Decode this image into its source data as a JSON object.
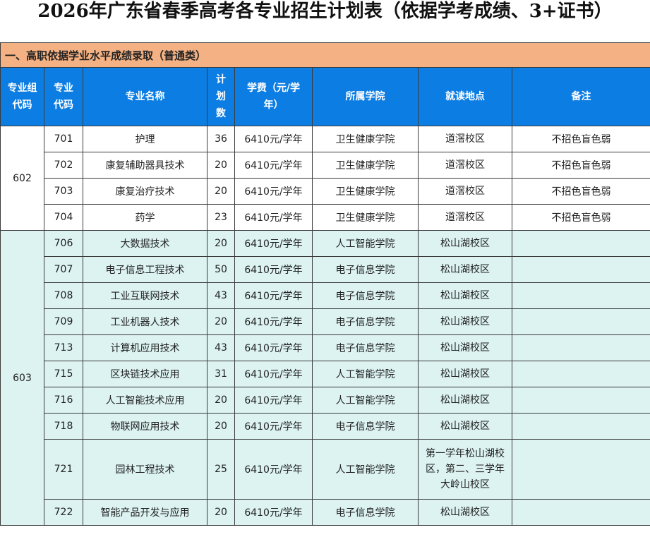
{
  "title": "2026年广东省春季高考各专业招生计划表（依据学考成绩、3+证书）",
  "section": "一、高职依据学业水平成绩录取（普通类）",
  "headers": {
    "group_code": "专业组代码",
    "major_code": "专业代码",
    "major_name": "专业名称",
    "plan": "计划数",
    "tuition": "学费（元/学年）",
    "college": "所属学院",
    "campus": "就读地点",
    "remark": "备注"
  },
  "groups": [
    {
      "code": "602",
      "rows": [
        {
          "code": "701",
          "name": "护理",
          "plan": "36",
          "fee": "6410元/学年",
          "college": "卫生健康学院",
          "campus": "道滘校区",
          "remark": "不招色盲色弱"
        },
        {
          "code": "702",
          "name": "康复辅助器具技术",
          "plan": "20",
          "fee": "6410元/学年",
          "college": "卫生健康学院",
          "campus": "道滘校区",
          "remark": "不招色盲色弱"
        },
        {
          "code": "703",
          "name": "康复治疗技术",
          "plan": "20",
          "fee": "6410元/学年",
          "college": "卫生健康学院",
          "campus": "道滘校区",
          "remark": "不招色盲色弱"
        },
        {
          "code": "704",
          "name": "药学",
          "plan": "23",
          "fee": "6410元/学年",
          "college": "卫生健康学院",
          "campus": "道滘校区",
          "remark": "不招色盲色弱"
        }
      ]
    },
    {
      "code": "603",
      "rows": [
        {
          "code": "706",
          "name": "大数据技术",
          "plan": "20",
          "fee": "6410元/学年",
          "college": "人工智能学院",
          "campus": "松山湖校区",
          "remark": ""
        },
        {
          "code": "707",
          "name": "电子信息工程技术",
          "plan": "50",
          "fee": "6410元/学年",
          "college": "电子信息学院",
          "campus": "松山湖校区",
          "remark": ""
        },
        {
          "code": "708",
          "name": "工业互联网技术",
          "plan": "43",
          "fee": "6410元/学年",
          "college": "电子信息学院",
          "campus": "松山湖校区",
          "remark": ""
        },
        {
          "code": "709",
          "name": "工业机器人技术",
          "plan": "20",
          "fee": "6410元/学年",
          "college": "电子信息学院",
          "campus": "松山湖校区",
          "remark": ""
        },
        {
          "code": "713",
          "name": "计算机应用技术",
          "plan": "43",
          "fee": "6410元/学年",
          "college": "电子信息学院",
          "campus": "松山湖校区",
          "remark": ""
        },
        {
          "code": "715",
          "name": "区块链技术应用",
          "plan": "31",
          "fee": "6410元/学年",
          "college": "人工智能学院",
          "campus": "松山湖校区",
          "remark": ""
        },
        {
          "code": "716",
          "name": "人工智能技术应用",
          "plan": "20",
          "fee": "6410元/学年",
          "college": "人工智能学院",
          "campus": "松山湖校区",
          "remark": ""
        },
        {
          "code": "718",
          "name": "物联网应用技术",
          "plan": "20",
          "fee": "6410元/学年",
          "college": "电子信息学院",
          "campus": "松山湖校区",
          "remark": ""
        },
        {
          "code": "721",
          "name": "园林工程技术",
          "plan": "25",
          "fee": "6410元/学年",
          "college": "人工智能学院",
          "campus": "第一学年松山湖校区，第二、三学年大岭山校区",
          "remark": ""
        },
        {
          "code": "722",
          "name": "智能产品开发与应用",
          "plan": "20",
          "fee": "6410元/学年",
          "college": "电子信息学院",
          "campus": "松山湖校区",
          "remark": ""
        }
      ]
    }
  ]
}
